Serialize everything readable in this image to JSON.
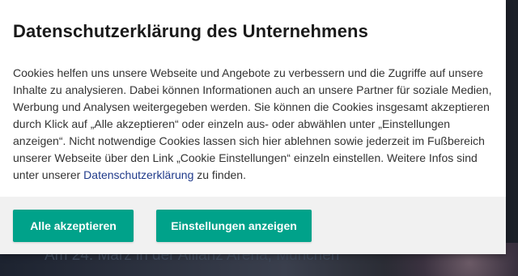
{
  "background": {
    "hero_text": "Am 24. März in der Allianz Arena, München"
  },
  "dialog": {
    "title": "Datenschutzerklärung des Unternehmens",
    "body_text": "Cookies helfen uns unsere Webseite und Angebote zu verbessern und die Zugriffe auf unsere Inhalte zu analysieren. Dabei können Informationen auch an unsere Partner für soziale Medien, Werbung und Analysen weitergegeben werden. Sie können die Cookies insgesamt akzeptieren durch Klick auf „Alle akzeptieren“ oder einzeln aus- oder abwählen unter „Einstellungen anzeigen“. Nicht notwendige Cookies lassen sich hier ablehnen sowie jederzeit im Fußbereich unserer Webseite über den Link „Cookie Einstellungen“ einzeln einstellen. Weitere Infos sind unter unserer",
    "privacy_link": "Datenschutzerklärung",
    "body_suffix": " zu finden.",
    "accept_all_label": "Alle akzeptieren",
    "show_settings_label": "Einstellungen anzeigen"
  },
  "colors": {
    "button_bg": "#00a28a",
    "link": "#1f3a8a",
    "footer_bg": "#f1f1f1"
  }
}
